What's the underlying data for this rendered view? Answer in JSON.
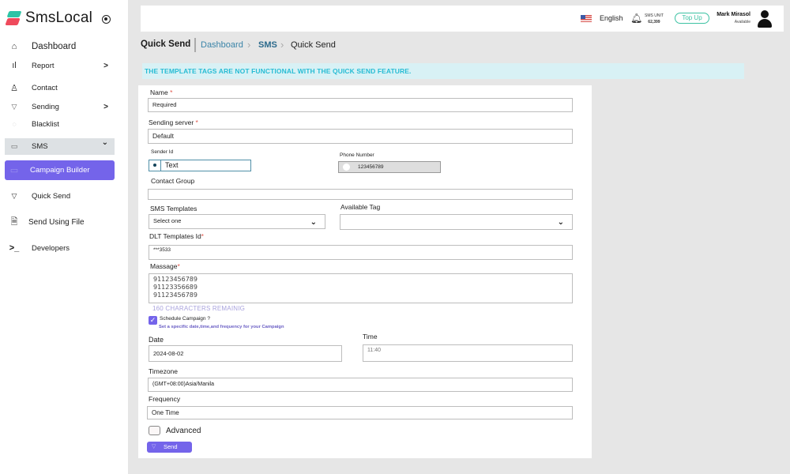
{
  "app": {
    "name": "SmsLocal"
  },
  "sidebar": {
    "items": [
      {
        "label": "Dashboard",
        "icon": "home-icon"
      },
      {
        "label": "Report",
        "icon": "bar-chart-icon",
        "chevron": ">"
      },
      {
        "label": "Contact",
        "icon": "user-icon"
      },
      {
        "label": "Sending",
        "icon": "send-icon",
        "chevron": ">"
      },
      {
        "label": "Blacklist",
        "icon": "shield-icon"
      },
      {
        "label": "SMS",
        "icon": "message-icon",
        "chevron": "⌄"
      },
      {
        "label": "Campaign Builder",
        "icon": "layout-icon"
      },
      {
        "label": "Quick Send",
        "icon": "send-icon"
      },
      {
        "label": "Send Using File",
        "icon": "file-icon"
      },
      {
        "label": "Developers",
        "icon": "terminal-icon"
      }
    ]
  },
  "header": {
    "language": "English",
    "sms_unit_label": "SMS UNIT",
    "sms_unit_value": "62,399",
    "topup_label": "Top Up",
    "user_name": "Mark Mirasol",
    "user_status": "Available"
  },
  "page": {
    "title": "Quick Send",
    "breadcrumb": [
      "Dashboard",
      "SMS",
      "Quick Send"
    ],
    "notice": "THE TEMPLATE TAGS ARE NOT FUNCTIONAL WITH THE QUICK SEND FEATURE."
  },
  "form": {
    "name": {
      "label": "Name",
      "required": "*",
      "value": "Required"
    },
    "sending_server": {
      "label": "Sending server",
      "required": "*",
      "value": "Default"
    },
    "sender_id": {
      "label": "Sender Id",
      "value": "Text"
    },
    "phone_number": {
      "label": "Phone Number",
      "value": "123456789"
    },
    "contact_group": {
      "label": "Contact Group",
      "value": ""
    },
    "sms_templates": {
      "label": "SMS Templates",
      "value": "Select one"
    },
    "available_tag": {
      "label": "Available Tag",
      "value": ""
    },
    "dlt_templates_id": {
      "label": "DLT Templates Id",
      "required": "*",
      "value": "***3533"
    },
    "message": {
      "label": "Massage",
      "required": "*",
      "lines": [
        "91123456789",
        "91123356689",
        "91123456789"
      ]
    },
    "characters_remaining": "160 CHARACTERS REMAINIG",
    "schedule": {
      "label": "Schedule Campaign ?",
      "checked": true,
      "subtitle": "Set a specific date,time,and frequency for your Campaign"
    },
    "date": {
      "label": "Date",
      "value": "2024-08-02"
    },
    "time": {
      "label": "Time",
      "value": "11:40"
    },
    "timezone": {
      "label": "Timezone",
      "value": "(GMT+08:00)Asia/Manila"
    },
    "frequency": {
      "label": "Frequency",
      "value": "One Time"
    },
    "advanced": {
      "label": "Advanced",
      "checked": false
    },
    "send_label": "Send"
  },
  "colors": {
    "accent": "#7464ea",
    "topup": "#3cc2a3",
    "notice_bg": "#d8f1f5",
    "notice_text": "#27bcd4",
    "required": "#e2574c"
  }
}
